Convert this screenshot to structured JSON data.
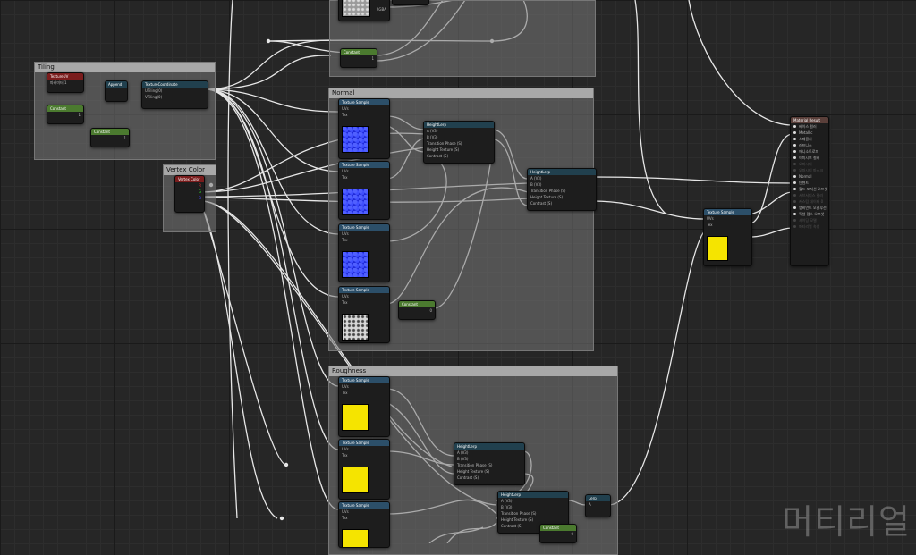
{
  "comments": {
    "tiling": "Tiling",
    "vertex_color": "Vertex Color",
    "normal": "Normal",
    "roughness": "Roughness"
  },
  "nodes": {
    "param_tiling": {
      "title": "TextureUV",
      "value": "파라미터 1"
    },
    "const_a": {
      "title": "Constant",
      "value": "1"
    },
    "const_b": {
      "title": "Constant",
      "value": "1"
    },
    "append": {
      "title": "Append"
    },
    "texcoord": {
      "title": "TextureCoordinate",
      "pin1": "UTiling(0)",
      "pin2": "VTiling(0)",
      "out": "Texture Coord"
    },
    "vertex_color": {
      "title": "Vertex Color"
    },
    "tex_sample_label": "Texture Sample",
    "tex_pins": {
      "uvs": "UVs",
      "tex": "Tex",
      "apply": "Apply View MipBias",
      "rgb": "RGB",
      "r": "R",
      "g": "G",
      "b": "B",
      "a": "A",
      "rgba": "RGBA"
    },
    "height_lerp": {
      "title": "HeightLerp",
      "a": "A (V3)",
      "b": "B (V3)",
      "phase": "Transition Phase (S)",
      "height": "Height Texture (S)",
      "contrast": "Contrast (S)",
      "results": "Results",
      "alpha": "Alpha",
      "lerp_alpha": "Lerp Alpha for Contrast"
    },
    "normal_const": {
      "title": "Constant",
      "value": "0"
    },
    "rough_const": {
      "title": "Constant",
      "value": "0"
    },
    "lerp_small": {
      "title": "Lerp",
      "a": "A",
      "b": "B",
      "alpha": "Alpha"
    }
  },
  "result_node": {
    "title": "Material Result",
    "pins": [
      {
        "label": "베이스 컬러",
        "active": true
      },
      {
        "label": "Metallic",
        "active": true
      },
      {
        "label": "스페큘러",
        "active": true
      },
      {
        "label": "러프니스",
        "active": true
      },
      {
        "label": "애니소트로피",
        "active": true
      },
      {
        "label": "이미시브 컬러",
        "active": true
      },
      {
        "label": "오파시티",
        "active": false
      },
      {
        "label": "오파시티 마스크",
        "active": false
      },
      {
        "label": "Normal",
        "active": true
      },
      {
        "label": "탄젠트",
        "active": true
      },
      {
        "label": "월드 포지션 오프셋",
        "active": true
      },
      {
        "label": "서브서피스 컬러",
        "active": false
      },
      {
        "label": "커스텀 데이터 0",
        "active": false
      },
      {
        "label": "앰비언트 오클루전",
        "active": true
      },
      {
        "label": "픽셀 뎁스 오프셋",
        "active": true
      },
      {
        "label": "셰이딩 모델",
        "active": false
      },
      {
        "label": "머티리얼 속성",
        "active": false
      }
    ]
  },
  "watermark": "머티리얼"
}
